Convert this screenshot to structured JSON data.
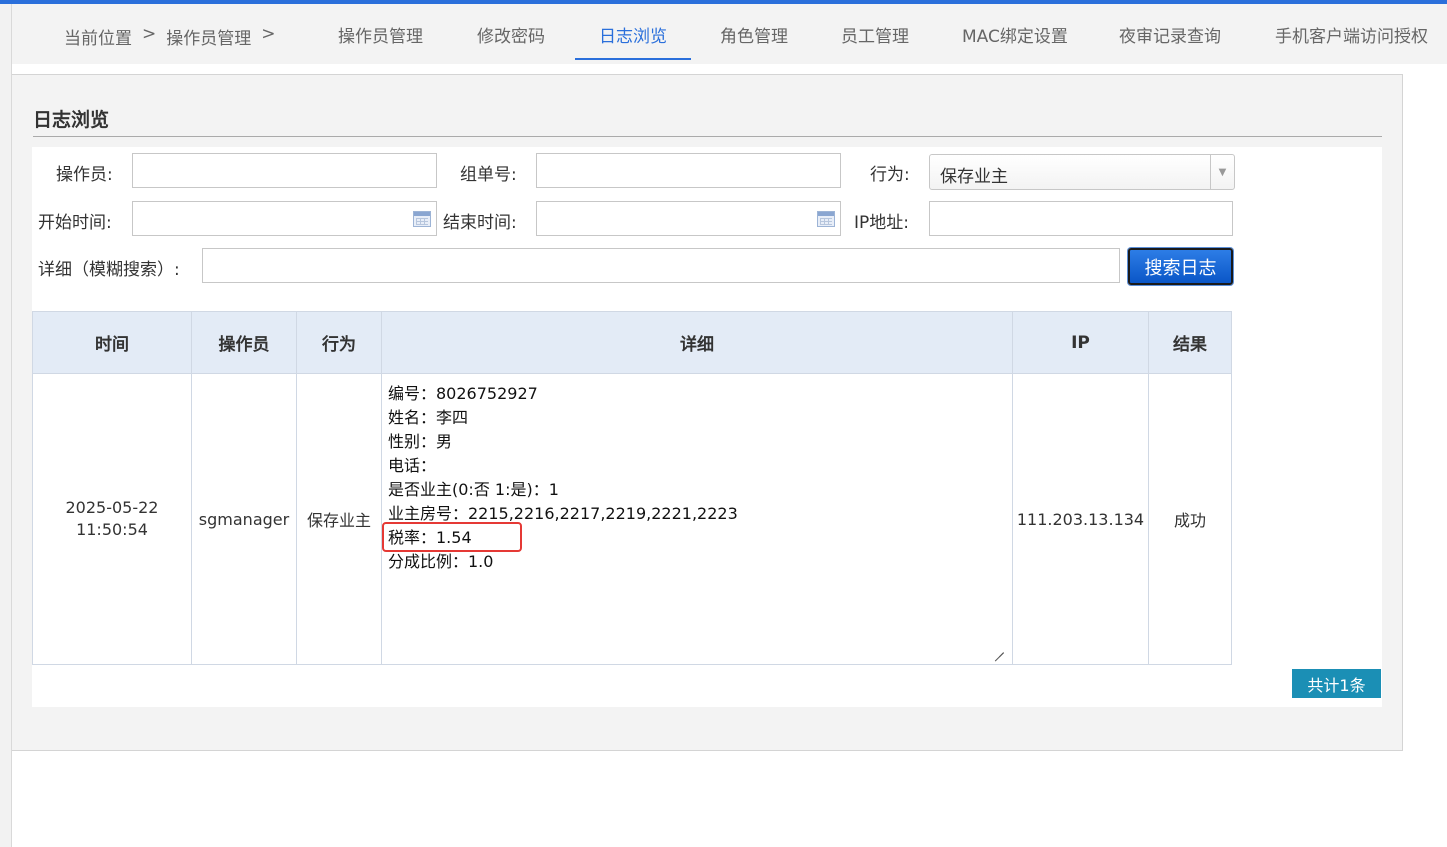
{
  "breadcrumb": {
    "prefix": "当前位置",
    "sep1": ">",
    "current": "操作员管理",
    "sep2": ">"
  },
  "tabs": [
    {
      "label": "操作员管理"
    },
    {
      "label": "修改密码"
    },
    {
      "label": "日志浏览",
      "active": true
    },
    {
      "label": "角色管理"
    },
    {
      "label": "员工管理"
    },
    {
      "label": "MAC绑定设置"
    },
    {
      "label": "夜审记录查询"
    },
    {
      "label": "手机客户端访问授权"
    }
  ],
  "panel": {
    "title": "日志浏览"
  },
  "form": {
    "operator_label": "操作员:",
    "operator_value": "",
    "group_label": "组单号:",
    "group_value": "",
    "action_label": "行为:",
    "action_selected": "保存业主",
    "start_label": "开始时间:",
    "start_value": "",
    "end_label": "结束时间:",
    "end_value": "",
    "ip_label": "IP地址:",
    "ip_value": "",
    "detail_label": "详细（模糊搜索）:",
    "detail_value": "",
    "search_button": "搜索日志"
  },
  "table": {
    "headers": [
      "时间",
      "操作员",
      "行为",
      "详细",
      "IP",
      "结果"
    ],
    "rows": [
      {
        "time_date": "2025-05-22",
        "time_clock": "11:50:54",
        "operator": "sgmanager",
        "action": "保存业主",
        "details": [
          "编号：8026752927",
          "姓名：李四",
          "性别：男",
          "电话：",
          "是否业主(0:否 1:是)：1",
          "业主房号：2215,2216,2217,2219,2221,2223",
          "税率：1.54",
          "分成比例：1.0"
        ],
        "ip": "111.203.13.134",
        "result": "成功"
      }
    ]
  },
  "total": "共计1条",
  "colors": {
    "accent": "#2a6fdb",
    "highlight_box": "#e53935",
    "badge": "#1b8fb5"
  }
}
